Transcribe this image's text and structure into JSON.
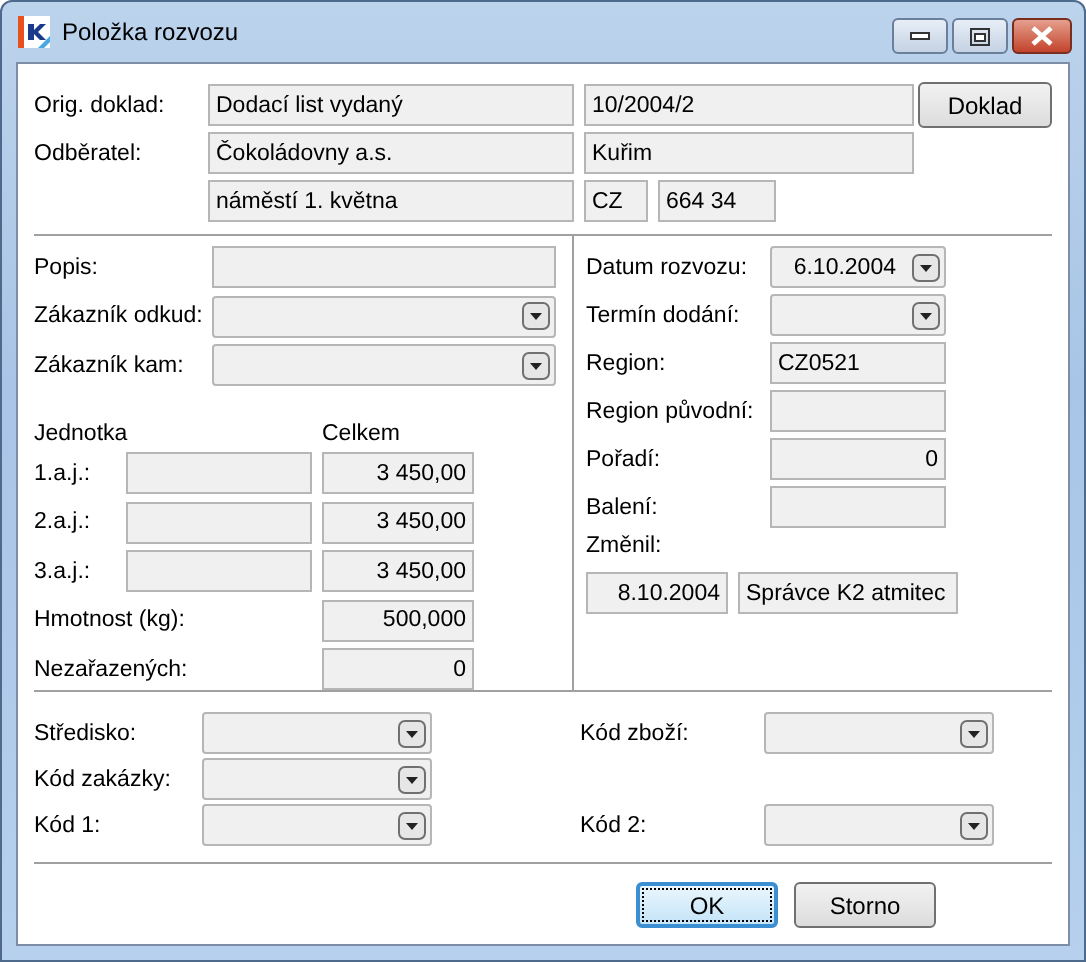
{
  "window": {
    "title": "Položka rozvozu"
  },
  "header": {
    "rows": [
      {
        "label": "Orig. doklad:",
        "fields": [
          {
            "kind": "text",
            "value": "Dodací list vydaný"
          },
          {
            "kind": "text",
            "value": "10/2004/2"
          }
        ],
        "button": "Doklad"
      },
      {
        "label": "Odběratel:",
        "fields": [
          {
            "kind": "text",
            "value": "Čokoládovny a.s."
          },
          {
            "kind": "text",
            "value": "Kuřim"
          }
        ]
      },
      {
        "fields": [
          {
            "kind": "text",
            "value": "náměstí 1. května"
          },
          {
            "kind": "text",
            "value": "CZ"
          },
          {
            "kind": "text",
            "value": "664 34"
          }
        ]
      }
    ]
  },
  "left": {
    "fields": [
      {
        "label": "Popis:",
        "kind": "text"
      },
      {
        "label": "Zákazník odkud:",
        "kind": "combo"
      },
      {
        "label": "Zákazník kam:",
        "kind": "combo"
      }
    ],
    "units_header": {
      "unit": "Jednotka",
      "total": "Celkem"
    },
    "units": [
      {
        "label": "1.a.j.:",
        "total": "3 450,00"
      },
      {
        "label": "2.a.j.:",
        "total": "3 450,00"
      },
      {
        "label": "3.a.j.:",
        "total": "3 450,00"
      }
    ],
    "totals": [
      {
        "label": "Hmotnost (kg):",
        "value": "500,000"
      },
      {
        "label": "Nezařazených:",
        "value": "0"
      }
    ]
  },
  "right": {
    "fields": [
      {
        "label": "Datum rozvozu:",
        "kind": "date",
        "value": "6.10.2004"
      },
      {
        "label": "Termín dodání:",
        "kind": "combo"
      },
      {
        "label": "Region:",
        "kind": "text",
        "value": "CZ0521"
      },
      {
        "label": "Region původní:",
        "kind": "text"
      },
      {
        "label": "Pořadí:",
        "kind": "number",
        "value": "0"
      },
      {
        "label": "Balení:",
        "kind": "text"
      }
    ],
    "changed": {
      "label": "Změnil:",
      "date": "8.10.2004",
      "user": "Správce K2 atmitec"
    }
  },
  "codes": [
    {
      "label": "Středisko:",
      "kind": "combo"
    },
    {
      "label": "Kód zboží:",
      "kind": "combo"
    },
    {
      "label": "Kód zakázky:",
      "kind": "combo"
    },
    {
      "kind": "empty"
    },
    {
      "label": "Kód 1:",
      "kind": "combo"
    },
    {
      "label": "Kód 2:",
      "kind": "combo"
    }
  ],
  "buttons": [
    {
      "label": "OK",
      "default": true
    },
    {
      "label": "Storno",
      "default": false
    }
  ]
}
